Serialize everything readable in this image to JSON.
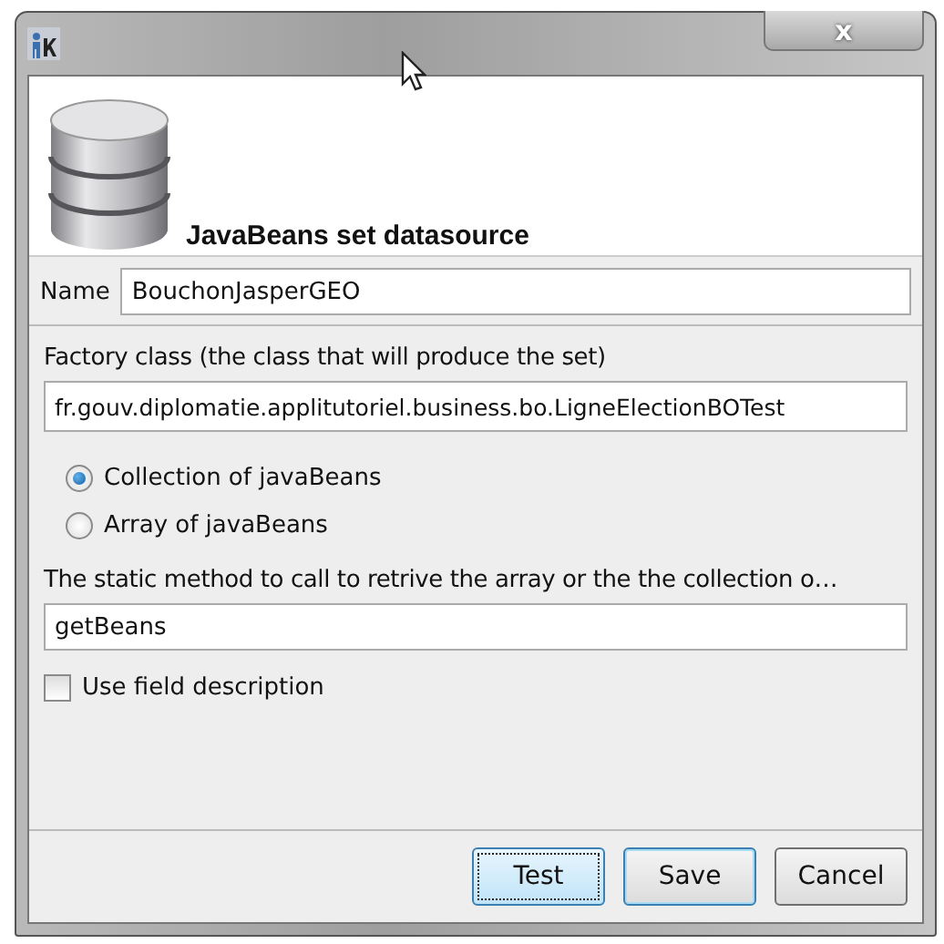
{
  "window": {
    "close_label": "x"
  },
  "header": {
    "title": "JavaBeans set datasource"
  },
  "name_field": {
    "label": "Name",
    "value": "BouchonJasperGEO"
  },
  "factory_field": {
    "label": "Factory class (the class that will produce the set)",
    "value": "fr.gouv.diplomatie.applitutoriel.business.bo.LigneElectionBOTest"
  },
  "source_options": [
    {
      "label": "Collection of javaBeans",
      "selected": true
    },
    {
      "label": "Array of javaBeans",
      "selected": false
    }
  ],
  "method_field": {
    "label": "The static method to call to retrive the array or the the collection o…",
    "value": "getBeans"
  },
  "use_field_description": {
    "label": "Use field description",
    "checked": false
  },
  "buttons": [
    {
      "label": "Test",
      "focused": true,
      "default": false
    },
    {
      "label": "Save",
      "focused": false,
      "default": true
    },
    {
      "label": "Cancel",
      "focused": false,
      "default": false
    }
  ]
}
